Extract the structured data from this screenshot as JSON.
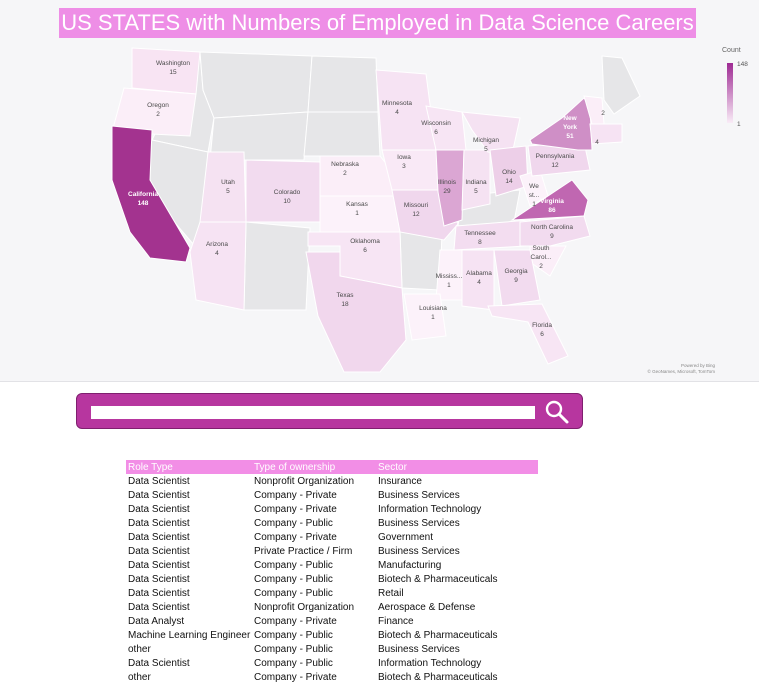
{
  "title": "US STATES with Numbers of Employed in Data Science Careers",
  "legend": {
    "title": "Count",
    "max": "148",
    "min": "1",
    "color_high": "#9e2a93",
    "color_low": "#f9ecf7"
  },
  "credit": {
    "line1": "Powered by Bing",
    "line2": "© GeoNames, Microsoft, TomTom"
  },
  "states": [
    {
      "name": "Washington",
      "count": "15"
    },
    {
      "name": "Oregon",
      "count": "2"
    },
    {
      "name": "California",
      "count": "148"
    },
    {
      "name": "Utah",
      "count": "5"
    },
    {
      "name": "Colorado",
      "count": "10"
    },
    {
      "name": "Arizona",
      "count": "4"
    },
    {
      "name": "Nebraska",
      "count": "2"
    },
    {
      "name": "Kansas",
      "count": "1"
    },
    {
      "name": "Oklahoma",
      "count": "6"
    },
    {
      "name": "Texas",
      "count": "18"
    },
    {
      "name": "Minnesota",
      "count": "4"
    },
    {
      "name": "Iowa",
      "count": "3"
    },
    {
      "name": "Missouri",
      "count": "12"
    },
    {
      "name": "Wisconsin",
      "count": "6"
    },
    {
      "name": "Illinois",
      "count": "29"
    },
    {
      "name": "Indiana",
      "count": "5"
    },
    {
      "name": "Michigan",
      "count": "5"
    },
    {
      "name": "Ohio",
      "count": "14"
    },
    {
      "name": "We st...",
      "count": "1"
    },
    {
      "name": "Virginia",
      "count": "86"
    },
    {
      "name": "Pennsylvania",
      "count": "12"
    },
    {
      "name": "New York",
      "count": "51"
    },
    {
      "name": "",
      "count": "2"
    },
    {
      "name": "",
      "count": "4"
    },
    {
      "name": "Tennessee",
      "count": "8"
    },
    {
      "name": "North Carolina",
      "count": "9"
    },
    {
      "name": "South Carol...",
      "count": "2"
    },
    {
      "name": "Mississ...",
      "count": "1"
    },
    {
      "name": "Alabama",
      "count": "4"
    },
    {
      "name": "Georgia",
      "count": "9"
    },
    {
      "name": "Louisiana",
      "count": "1"
    },
    {
      "name": "Florida",
      "count": "6"
    }
  ],
  "search": {
    "placeholder": "",
    "value": ""
  },
  "table": {
    "headers": [
      "Role Type",
      "Type of ownership",
      "Sector"
    ],
    "rows": [
      [
        "Data Scientist",
        "Nonprofit Organization",
        "Insurance"
      ],
      [
        "Data Scientist",
        "Company - Private",
        "Business Services"
      ],
      [
        "Data Scientist",
        "Company - Private",
        "Information Technology"
      ],
      [
        "Data Scientist",
        "Company - Public",
        "Business Services"
      ],
      [
        "Data Scientist",
        "Company - Private",
        "Government"
      ],
      [
        "Data Scientist",
        "Private Practice / Firm",
        "Business Services"
      ],
      [
        "Data Scientist",
        "Company - Public",
        "Manufacturing"
      ],
      [
        "Data Scientist",
        "Company - Public",
        "Biotech & Pharmaceuticals"
      ],
      [
        "Data Scientist",
        "Company - Public",
        "Retail"
      ],
      [
        "Data Scientist",
        "Nonprofit Organization",
        "Aerospace & Defense"
      ],
      [
        "Data Analyst",
        "Company - Private",
        "Finance"
      ],
      [
        "Machine Learning Engineer",
        "Company - Public",
        "Biotech & Pharmaceuticals"
      ],
      [
        "other",
        "Company - Public",
        "Business Services"
      ],
      [
        "Data Scientist",
        "Company - Public",
        "Information Technology"
      ],
      [
        "other",
        "Company - Private",
        "Biotech & Pharmaceuticals"
      ]
    ]
  }
}
